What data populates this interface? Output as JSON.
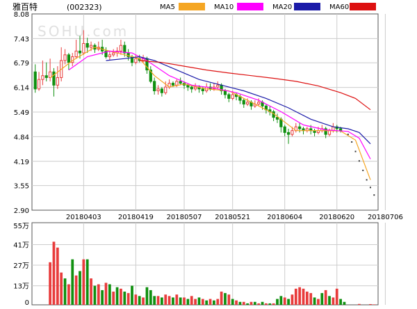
{
  "header": {
    "stock_name": "雅百特",
    "stock_code": "(002323)",
    "watermark": "SOHU.com"
  },
  "legend": [
    {
      "label": "MA5",
      "color": "#f5a623"
    },
    {
      "label": "MA10",
      "color": "#ff00ff"
    },
    {
      "label": "MA20",
      "color": "#1a1aa8"
    },
    {
      "label": "MA60",
      "color": "#dd1010"
    }
  ],
  "colors": {
    "up": "#e83c3c",
    "down": "#109010",
    "grid": "#cccccc",
    "frame": "#555555"
  },
  "chart_data": [
    {
      "type": "candlestick",
      "title": "雅百特 (002323)",
      "y_ticks": [
        "8.08",
        "7.43",
        "6.79",
        "6.14",
        "5.49",
        "4.84",
        "4.19",
        "3.55",
        "2.90"
      ],
      "ylim": [
        2.9,
        8.08
      ],
      "x_ticks": [
        {
          "label": "20180403",
          "index": 13
        },
        {
          "label": "20180419",
          "index": 27
        },
        {
          "label": "20180507",
          "index": 40
        },
        {
          "label": "20180521",
          "index": 53
        },
        {
          "label": "20180604",
          "index": 67
        },
        {
          "label": "20180620",
          "index": 81
        },
        {
          "label": "20180706",
          "index": 94
        }
      ],
      "candles": [
        [
          6.55,
          6.1,
          6.75,
          6.0
        ],
        [
          6.1,
          6.35,
          6.55,
          6.05
        ],
        [
          6.35,
          6.45,
          6.85,
          6.2
        ],
        [
          6.45,
          6.4,
          6.8,
          6.3
        ],
        [
          6.4,
          6.55,
          6.9,
          6.3
        ],
        [
          6.55,
          6.2,
          6.65,
          5.9
        ],
        [
          6.2,
          6.4,
          6.7,
          6.1
        ],
        [
          6.4,
          6.85,
          7.2,
          6.3
        ],
        [
          6.85,
          7.0,
          7.15,
          6.75
        ],
        [
          7.0,
          6.8,
          7.05,
          6.6
        ],
        [
          6.8,
          6.95,
          7.05,
          6.7
        ],
        [
          6.95,
          7.1,
          7.4,
          6.9
        ],
        [
          7.1,
          7.05,
          7.5,
          6.9
        ],
        [
          7.05,
          7.3,
          7.65,
          7.0
        ],
        [
          7.3,
          7.2,
          7.45,
          7.05
        ],
        [
          7.2,
          7.25,
          7.35,
          7.1
        ],
        [
          7.25,
          7.15,
          7.3,
          7.05
        ],
        [
          7.15,
          7.2,
          7.35,
          7.1
        ],
        [
          7.2,
          7.1,
          7.4,
          7.0
        ],
        [
          7.1,
          6.95,
          7.2,
          6.9
        ],
        [
          6.95,
          7.0,
          7.1,
          6.85
        ],
        [
          7.0,
          7.05,
          7.15,
          6.95
        ],
        [
          7.05,
          7.1,
          7.2,
          6.95
        ],
        [
          7.1,
          7.25,
          7.4,
          7.0
        ],
        [
          7.25,
          7.05,
          7.35,
          6.95
        ],
        [
          7.05,
          6.95,
          7.15,
          6.85
        ],
        [
          6.95,
          6.8,
          7.0,
          6.7
        ],
        [
          6.8,
          6.9,
          7.0,
          6.75
        ],
        [
          6.9,
          6.85,
          7.0,
          6.8
        ],
        [
          6.85,
          6.9,
          7.0,
          6.8
        ],
        [
          6.9,
          6.6,
          6.95,
          6.5
        ],
        [
          6.6,
          6.3,
          6.7,
          6.25
        ],
        [
          6.3,
          6.05,
          6.4,
          5.95
        ],
        [
          6.05,
          6.1,
          6.2,
          5.95
        ],
        [
          6.1,
          6.0,
          6.15,
          5.9
        ],
        [
          6.0,
          6.15,
          6.3,
          5.95
        ],
        [
          6.15,
          6.25,
          6.35,
          6.1
        ],
        [
          6.25,
          6.2,
          6.3,
          6.15
        ],
        [
          6.2,
          6.3,
          6.35,
          6.15
        ],
        [
          6.3,
          6.25,
          6.4,
          6.2
        ],
        [
          6.25,
          6.2,
          6.3,
          6.1
        ],
        [
          6.2,
          6.15,
          6.25,
          6.05
        ],
        [
          6.15,
          6.1,
          6.2,
          6.0
        ],
        [
          6.1,
          6.15,
          6.25,
          6.05
        ],
        [
          6.15,
          6.1,
          6.2,
          6.0
        ],
        [
          6.1,
          6.05,
          6.15,
          5.95
        ],
        [
          6.05,
          6.15,
          6.25,
          6.0
        ],
        [
          6.15,
          6.1,
          6.25,
          6.05
        ],
        [
          6.1,
          6.15,
          6.25,
          6.05
        ],
        [
          6.15,
          6.2,
          6.3,
          6.1
        ],
        [
          6.2,
          6.05,
          6.25,
          5.95
        ],
        [
          6.05,
          5.95,
          6.1,
          5.85
        ],
        [
          5.95,
          5.85,
          6.0,
          5.75
        ],
        [
          5.85,
          5.95,
          6.05,
          5.8
        ],
        [
          5.95,
          5.9,
          6.0,
          5.8
        ],
        [
          5.9,
          5.8,
          5.95,
          5.7
        ],
        [
          5.8,
          5.7,
          5.85,
          5.6
        ],
        [
          5.7,
          5.75,
          5.85,
          5.65
        ],
        [
          5.75,
          5.65,
          5.8,
          5.55
        ],
        [
          5.65,
          5.7,
          5.8,
          5.6
        ],
        [
          5.7,
          5.75,
          5.85,
          5.65
        ],
        [
          5.75,
          5.65,
          5.8,
          5.55
        ],
        [
          5.65,
          5.55,
          5.7,
          5.45
        ],
        [
          5.55,
          5.5,
          5.65,
          5.4
        ],
        [
          5.5,
          5.35,
          5.55,
          5.25
        ],
        [
          5.35,
          5.3,
          5.45,
          5.2
        ],
        [
          5.3,
          5.1,
          5.35,
          4.95
        ],
        [
          5.1,
          4.95,
          5.15,
          4.85
        ],
        [
          4.95,
          4.9,
          5.05,
          4.65
        ],
        [
          4.9,
          5.0,
          5.1,
          4.85
        ],
        [
          5.0,
          5.1,
          5.2,
          4.95
        ],
        [
          5.1,
          5.05,
          5.2,
          4.95
        ],
        [
          5.05,
          5.0,
          5.1,
          4.9
        ],
        [
          5.0,
          5.05,
          5.1,
          4.95
        ],
        [
          5.05,
          5.0,
          5.15,
          4.9
        ],
        [
          5.0,
          4.95,
          5.05,
          4.85
        ],
        [
          4.95,
          5.0,
          5.1,
          4.9
        ],
        [
          5.0,
          5.05,
          5.15,
          4.95
        ],
        [
          5.05,
          4.9,
          5.1,
          4.8
        ],
        [
          4.9,
          5.0,
          5.05,
          4.85
        ],
        [
          5.0,
          5.1,
          5.2,
          4.95
        ],
        [
          5.1,
          5.05,
          5.15,
          4.95
        ],
        [
          5.05,
          5.0,
          5.1,
          4.95
        ]
      ],
      "limit_down_dots": [
        [
          84,
          4.9
        ],
        [
          85,
          4.7
        ],
        [
          86,
          4.45
        ],
        [
          87,
          4.2
        ],
        [
          88,
          3.95
        ],
        [
          89,
          3.7
        ],
        [
          90,
          3.5
        ],
        [
          91,
          3.3
        ]
      ],
      "ma_lines": [
        {
          "name": "MA5",
          "values": [
            [
              4,
              6.39
            ],
            [
              10,
              6.85
            ],
            [
              16,
              7.2
            ],
            [
              22,
              7.05
            ],
            [
              28,
              6.9
            ],
            [
              32,
              6.45
            ],
            [
              36,
              6.15
            ],
            [
              40,
              6.23
            ],
            [
              46,
              6.1
            ],
            [
              52,
              6.05
            ],
            [
              58,
              5.75
            ],
            [
              64,
              5.45
            ],
            [
              70,
              5.0
            ],
            [
              76,
              5.0
            ],
            [
              82,
              4.99
            ],
            [
              86,
              4.75
            ],
            [
              90,
              3.7
            ]
          ]
        },
        {
          "name": "MA10",
          "values": [
            [
              9,
              6.6
            ],
            [
              14,
              6.95
            ],
            [
              20,
              7.1
            ],
            [
              26,
              7.05
            ],
            [
              30,
              6.85
            ],
            [
              36,
              6.45
            ],
            [
              42,
              6.2
            ],
            [
              48,
              6.12
            ],
            [
              54,
              6.0
            ],
            [
              60,
              5.8
            ],
            [
              66,
              5.5
            ],
            [
              72,
              5.15
            ],
            [
              78,
              5.02
            ],
            [
              84,
              4.98
            ],
            [
              87,
              4.8
            ],
            [
              90,
              4.25
            ]
          ]
        },
        {
          "name": "MA20",
          "values": [
            [
              19,
              6.85
            ],
            [
              24,
              6.9
            ],
            [
              28,
              6.95
            ],
            [
              32,
              6.85
            ],
            [
              38,
              6.6
            ],
            [
              44,
              6.35
            ],
            [
              50,
              6.2
            ],
            [
              56,
              6.05
            ],
            [
              62,
              5.85
            ],
            [
              68,
              5.6
            ],
            [
              74,
              5.3
            ],
            [
              80,
              5.1
            ],
            [
              84,
              5.05
            ],
            [
              87,
              4.95
            ],
            [
              90,
              4.65
            ]
          ]
        },
        {
          "name": "MA60",
          "values": [
            [
              28,
              6.85
            ],
            [
              34,
              6.8
            ],
            [
              40,
              6.7
            ],
            [
              46,
              6.6
            ],
            [
              52,
              6.52
            ],
            [
              58,
              6.45
            ],
            [
              64,
              6.38
            ],
            [
              70,
              6.3
            ],
            [
              76,
              6.18
            ],
            [
              82,
              6.0
            ],
            [
              86,
              5.85
            ],
            [
              90,
              5.55
            ]
          ]
        }
      ]
    },
    {
      "type": "bar",
      "title": "",
      "y_ticks": [
        "55万",
        "41万",
        "27万",
        "13万",
        "0"
      ],
      "ylim": [
        0,
        55
      ],
      "unit": "万",
      "values": [
        [
          4,
          29,
          "up"
        ],
        [
          5,
          43,
          "up"
        ],
        [
          6,
          39,
          "up"
        ],
        [
          7,
          22,
          "up"
        ],
        [
          8,
          18,
          "down"
        ],
        [
          9,
          14,
          "up"
        ],
        [
          10,
          31,
          "down"
        ],
        [
          11,
          20,
          "up"
        ],
        [
          12,
          23,
          "down"
        ],
        [
          13,
          31,
          "up"
        ],
        [
          14,
          31,
          "down"
        ],
        [
          15,
          18,
          "up"
        ],
        [
          16,
          13,
          "down"
        ],
        [
          17,
          14,
          "up"
        ],
        [
          18,
          10,
          "down"
        ],
        [
          19,
          15,
          "up"
        ],
        [
          20,
          14,
          "down"
        ],
        [
          21,
          9,
          "up"
        ],
        [
          22,
          12,
          "down"
        ],
        [
          23,
          11,
          "up"
        ],
        [
          24,
          9,
          "down"
        ],
        [
          25,
          8,
          "up"
        ],
        [
          26,
          13,
          "down"
        ],
        [
          27,
          7,
          "up"
        ],
        [
          28,
          6,
          "down"
        ],
        [
          29,
          5,
          "up"
        ],
        [
          30,
          12,
          "down"
        ],
        [
          31,
          10,
          "down"
        ],
        [
          32,
          6,
          "down"
        ],
        [
          33,
          6,
          "up"
        ],
        [
          34,
          5,
          "down"
        ],
        [
          35,
          7,
          "up"
        ],
        [
          36,
          6,
          "up"
        ],
        [
          37,
          5,
          "down"
        ],
        [
          38,
          7,
          "up"
        ],
        [
          39,
          5,
          "down"
        ],
        [
          40,
          5,
          "up"
        ],
        [
          41,
          4,
          "down"
        ],
        [
          42,
          6,
          "up"
        ],
        [
          43,
          4,
          "up"
        ],
        [
          44,
          5,
          "down"
        ],
        [
          45,
          4,
          "up"
        ],
        [
          46,
          3,
          "down"
        ],
        [
          47,
          4,
          "up"
        ],
        [
          48,
          3,
          "down"
        ],
        [
          49,
          4,
          "up"
        ],
        [
          50,
          9,
          "up"
        ],
        [
          51,
          8,
          "down"
        ],
        [
          52,
          7,
          "up"
        ],
        [
          53,
          4,
          "down"
        ],
        [
          54,
          3,
          "up"
        ],
        [
          55,
          2,
          "down"
        ],
        [
          56,
          2,
          "up"
        ],
        [
          57,
          1,
          "down"
        ],
        [
          58,
          2,
          "up"
        ],
        [
          59,
          2,
          "down"
        ],
        [
          60,
          1,
          "up"
        ],
        [
          61,
          2,
          "down"
        ],
        [
          62,
          1,
          "up"
        ],
        [
          63,
          1,
          "down"
        ],
        [
          64,
          1,
          "up"
        ],
        [
          65,
          4,
          "down"
        ],
        [
          66,
          6,
          "down"
        ],
        [
          67,
          5,
          "up"
        ],
        [
          68,
          4,
          "down"
        ],
        [
          69,
          7,
          "up"
        ],
        [
          70,
          11,
          "up"
        ],
        [
          71,
          12,
          "up"
        ],
        [
          72,
          11,
          "up"
        ],
        [
          73,
          9,
          "up"
        ],
        [
          74,
          8,
          "up"
        ],
        [
          75,
          5,
          "down"
        ],
        [
          76,
          4,
          "up"
        ],
        [
          77,
          8,
          "down"
        ],
        [
          78,
          10,
          "up"
        ],
        [
          79,
          6,
          "down"
        ],
        [
          80,
          5,
          "up"
        ],
        [
          81,
          11,
          "up"
        ],
        [
          82,
          4,
          "down"
        ],
        [
          83,
          2,
          "down"
        ],
        [
          87,
          0.6,
          "up"
        ],
        [
          90,
          0.5,
          "up"
        ],
        [
          91,
          0.3,
          "up"
        ]
      ]
    }
  ]
}
